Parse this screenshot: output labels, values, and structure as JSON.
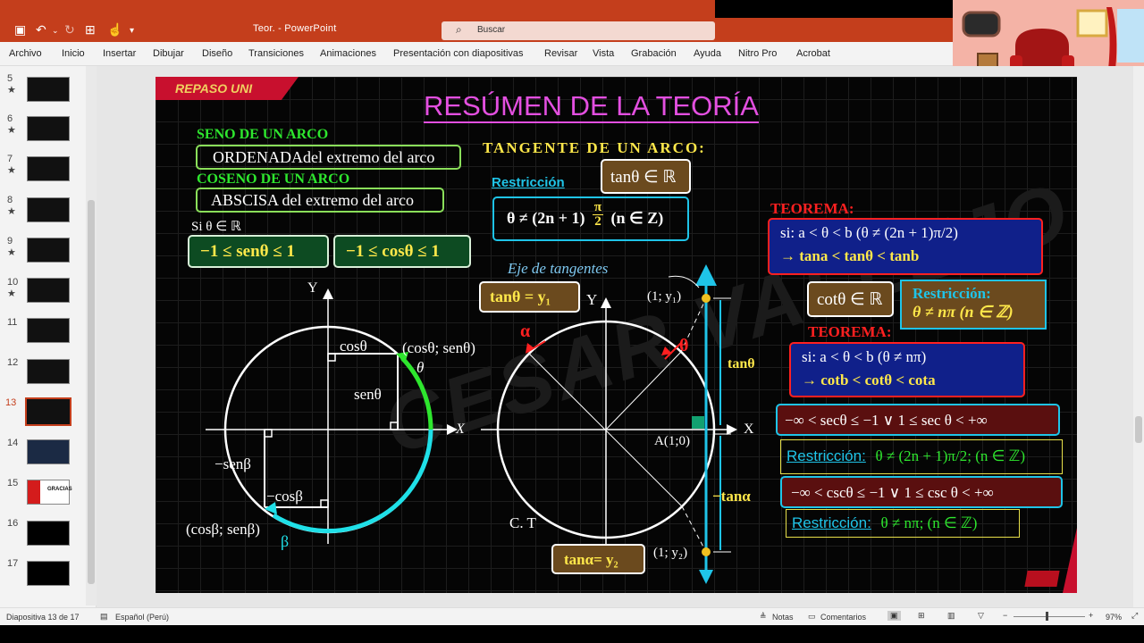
{
  "app": {
    "doc_title": "Teor. - PowerPoint",
    "search_placeholder": "Buscar"
  },
  "ribbon_tabs": [
    "Archivo",
    "Inicio",
    "Insertar",
    "Dibujar",
    "Diseño",
    "Transiciones",
    "Animaciones",
    "Presentación con diapositivas",
    "Revisar",
    "Vista",
    "Grabación",
    "Ayuda",
    "Nitro Pro",
    "Acrobat"
  ],
  "thumbnails": [
    {
      "num": "5",
      "star": "★"
    },
    {
      "num": "6",
      "star": "★"
    },
    {
      "num": "7",
      "star": "★"
    },
    {
      "num": "8",
      "star": "★"
    },
    {
      "num": "9",
      "star": "★"
    },
    {
      "num": "10",
      "star": "★"
    },
    {
      "num": "11",
      "star": ""
    },
    {
      "num": "12",
      "star": ""
    },
    {
      "num": "13",
      "star": ""
    },
    {
      "num": "14",
      "star": ""
    },
    {
      "num": "15",
      "star": ""
    },
    {
      "num": "16",
      "star": ""
    },
    {
      "num": "17",
      "star": ""
    }
  ],
  "thumb15_text": "GRACIAS",
  "status": {
    "slide_info": "Diapositiva 13 de 17",
    "language": "Español (Perú)",
    "notes": "Notas",
    "comments": "Comentarios",
    "zoom": "97%",
    "zoom_level": 0.97
  },
  "slide": {
    "badge": "REPASO UNI",
    "title": "RESÚMEN DE LA TEORÍA",
    "seno_head": "SENO  DE UN ARCO",
    "seno_box": "ORDENADAdel extremo del arco",
    "coseno_head": "COSENO DE UN ARCO",
    "coseno_box": "ABSCISA del extremo del arco",
    "si_theta": "Si θ ∈ ℝ",
    "sen_range": "−1 ≤ senθ ≤ 1",
    "cos_range": "−1 ≤ cosθ ≤ 1",
    "tan_head": "TANGENTE  DE  UN  ARCO:",
    "restriccion": "Restricción",
    "tan_real": "tanθ ∈ ℝ",
    "tan_restr_pre": "θ ≠ (2n + 1)",
    "pi": "π",
    "two": "2",
    "tan_restr_post": "(n ∈ Z)",
    "teorema1_head": "TEOREMA:",
    "teorema1_line1": "si:     a < θ < b     (θ ≠ (2n + 1)π/2)",
    "teorema1_line2": "→  tana < tanθ < tanb",
    "cot_real": "cotθ ∈ ℝ",
    "cot_restr_head": "Restricción:",
    "cot_restr": "θ ≠ nπ (n ∈ ℤ)",
    "teorema2_head": "TEOREMA:",
    "teorema2_line1": "si:      a < θ < b     (θ ≠ nπ)",
    "teorema2_line2": "→   cotb < cotθ < cota",
    "sec_range": "−∞ < secθ ≤ −1 ∨ 1 ≤ sec θ < +∞",
    "sec_restr_label": "Restricción:",
    "sec_restr": "θ ≠ (2n + 1)π/2; (n ∈ ℤ)",
    "csc_range": "−∞ < cscθ ≤ −1 ∨ 1 ≤ csc θ < +∞",
    "csc_restr_label": "Restricción:",
    "csc_restr": "θ ≠ nπ;  (n ∈ ℤ)",
    "eje_tangentes": "Eje  de  tangentes",
    "tan_y1": "tanθ = y₁",
    "tan_y2": "tanα= y₂",
    "ct": "C. T",
    "label_Y": "Y",
    "label_X": "X",
    "cos_theta": "cosθ",
    "sen_theta": "senθ",
    "point_theta": "(cosθ; senθ)",
    "theta": "θ",
    "neg_sen_beta": "−senβ",
    "neg_cos_beta": "−cosβ",
    "point_beta": "(cosβ; senβ)",
    "beta": "β",
    "alpha": "α",
    "p1": "(1; y₁)",
    "p2": "(1; y₂)",
    "A": "A(1;0)",
    "tan_theta_lbl": "tanθ",
    "neg_tan_alpha": "−tanα",
    "watermark": "CESAR VALLEJO"
  },
  "colors": {
    "ppt_red": "#c43e1c",
    "title_magenta": "#e34fe0",
    "green": "#2ee62e",
    "yellow": "#ffe84a",
    "cyan": "#1fc4e8",
    "red": "#ff2020",
    "brown": "#6b4a1e",
    "navy": "#10208a",
    "maroon": "#5a0f0f"
  }
}
